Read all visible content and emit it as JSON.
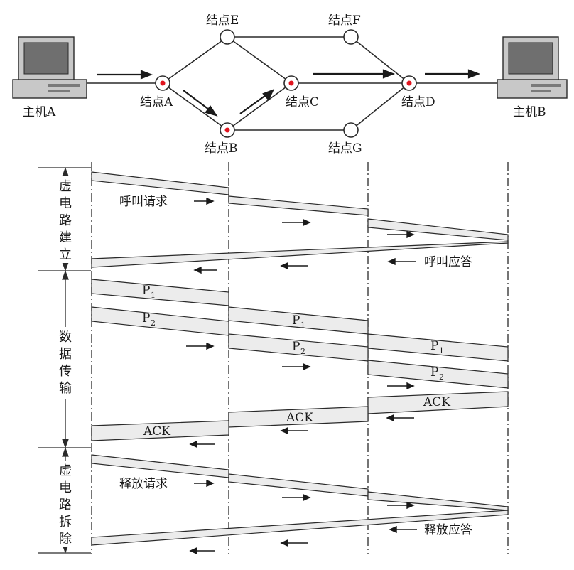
{
  "colors": {
    "line": "#2a2a2a",
    "node_fill": "#ffffff",
    "node_dot": "#e0141e",
    "band_fill": "#ececec",
    "monitor_body": "#c8c8c8",
    "screen": "#6f6f6f"
  },
  "network": {
    "hosts": [
      {
        "id": "A",
        "label": "主机A"
      },
      {
        "id": "B",
        "label": "主机B"
      }
    ],
    "nodes": [
      {
        "id": "A",
        "label": "结点A",
        "active": true
      },
      {
        "id": "B",
        "label": "结点B",
        "active": true
      },
      {
        "id": "C",
        "label": "结点C",
        "active": true
      },
      {
        "id": "D",
        "label": "结点D",
        "active": true
      },
      {
        "id": "E",
        "label": "结点E",
        "active": false
      },
      {
        "id": "F",
        "label": "结点F",
        "active": false
      },
      {
        "id": "G",
        "label": "结点G",
        "active": false
      }
    ],
    "links": [
      [
        "A",
        "E"
      ],
      [
        "A",
        "B"
      ],
      [
        "E",
        "C"
      ],
      [
        "B",
        "C"
      ],
      [
        "E",
        "F"
      ],
      [
        "F",
        "D"
      ],
      [
        "B",
        "G"
      ],
      [
        "G",
        "D"
      ],
      [
        "C",
        "D"
      ]
    ],
    "virtual_circuit_path": [
      "主机A",
      "结点A",
      "结点B",
      "结点C",
      "结点D",
      "主机B"
    ]
  },
  "phases": [
    {
      "id": "setup",
      "label": "虚电路建立",
      "chars": [
        "虚",
        "电",
        "路",
        "建",
        "立"
      ]
    },
    {
      "id": "transfer",
      "label": "数据传输",
      "chars": [
        "数",
        "据",
        "传",
        "输"
      ]
    },
    {
      "id": "teardown",
      "label": "虚电路拆除",
      "chars": [
        "虚",
        "电",
        "路",
        "拆",
        "除"
      ]
    }
  ],
  "messages": {
    "call_request": "呼叫请求",
    "call_accept": "呼叫应答",
    "release_request": "释放请求",
    "release_accept": "释放应答",
    "ack": "ACK",
    "packet_prefix": "P",
    "packet_1_sub": "1",
    "packet_2_sub": "2"
  }
}
